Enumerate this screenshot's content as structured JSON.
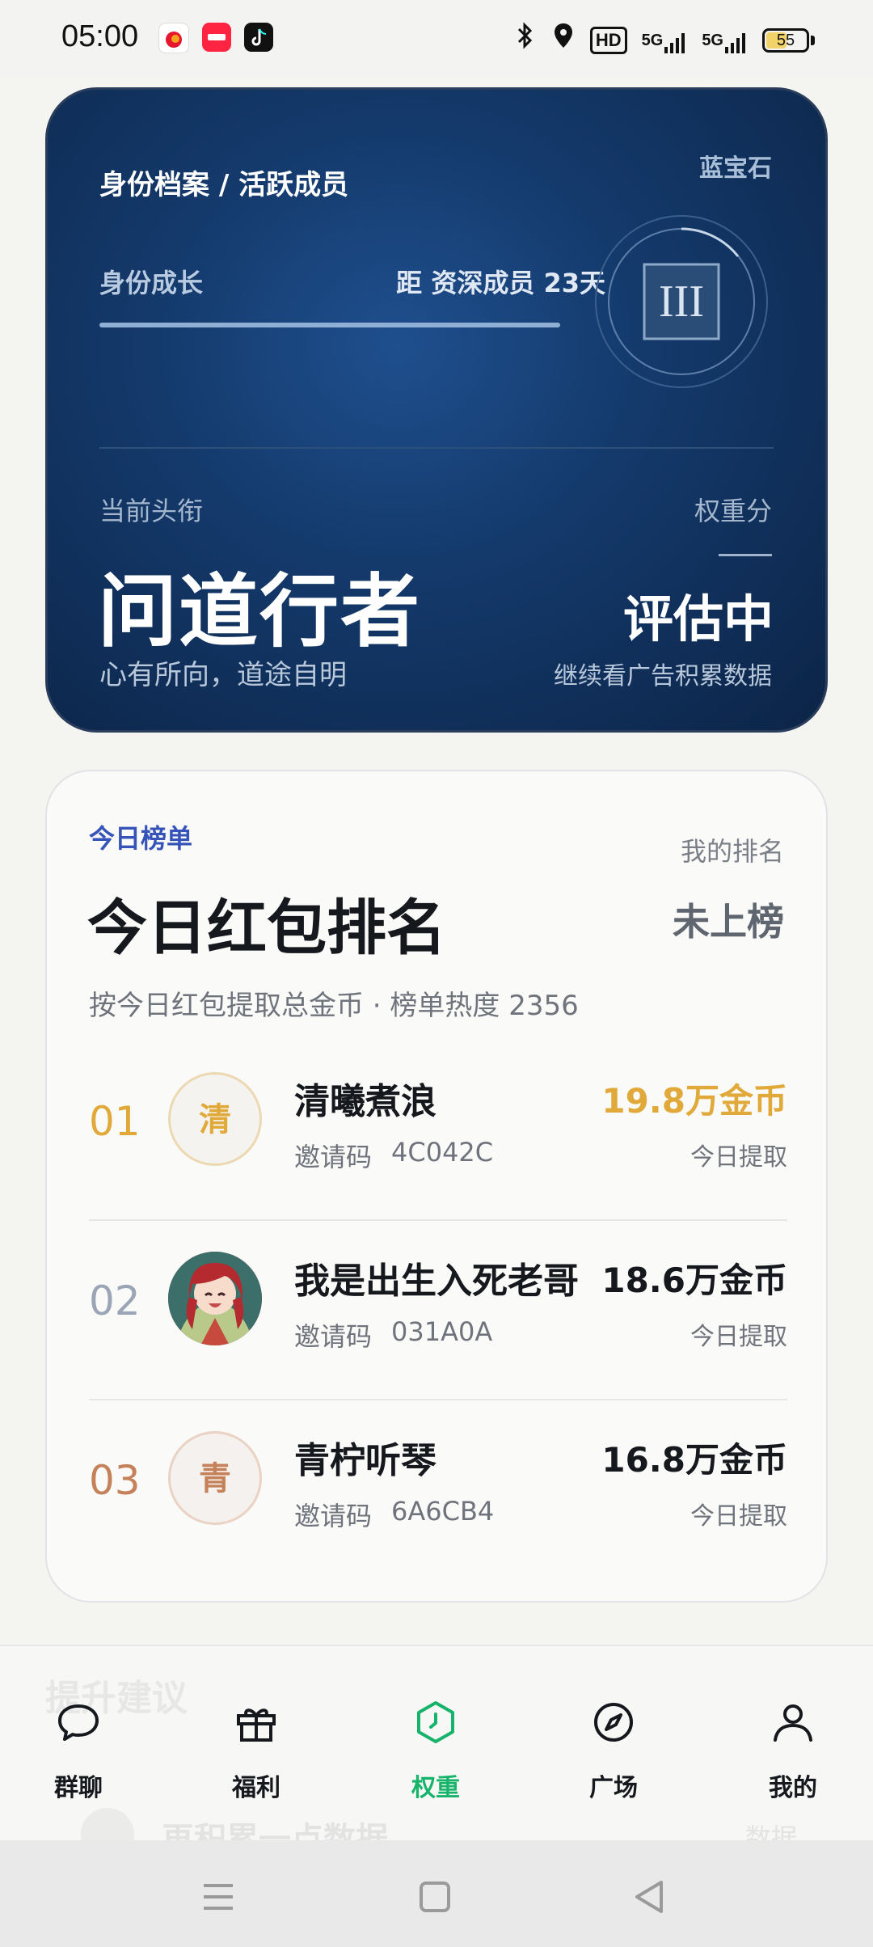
{
  "status_bar": {
    "time": "05:00",
    "battery": "55",
    "battery_level": 0.55,
    "icons": [
      "bluetooth-icon",
      "location-icon",
      "hd-icon",
      "5g-signal-icon",
      "5g-signal-icon",
      "battery-icon"
    ],
    "hd": "HD",
    "net1": "5G",
    "net2": "5G"
  },
  "identity": {
    "breadcrumb": "身份档案 / 活跃成员",
    "level": "蓝宝石",
    "growth_label": "身份成长",
    "growth_distance": "距 资深成员 23天",
    "growth_progress": 1.0,
    "badge_numeral": "III",
    "title_label": "当前头衔",
    "title": "问道行者",
    "subtitle": "心有所向，道途自明",
    "weight_label": "权重分",
    "weight_value": "评估中",
    "weight_hint": "继续看广告积累数据"
  },
  "ranking": {
    "eyebrow": "今日榜单",
    "my_rank_label": "我的排名",
    "title": "今日红包排名",
    "my_rank_status": "未上榜",
    "subtitle": "按今日红包提取总金币 · 榜单热度 2356",
    "code_label": "邀请码",
    "rows": [
      {
        "rank": "01",
        "avatar_char": "清",
        "name": "清曦煮浪",
        "code": "4C042C",
        "amount": "19.8万金币",
        "note": "今日提取"
      },
      {
        "rank": "02",
        "avatar_char": "",
        "name": "我是出生入死老哥",
        "code": "031A0A",
        "amount": "18.6万金币",
        "note": "今日提取"
      },
      {
        "rank": "03",
        "avatar_char": "青",
        "name": "青柠听琴",
        "code": "6A6CB4",
        "amount": "16.8万金币",
        "note": "今日提取"
      }
    ]
  },
  "peek": {
    "section_title": "提升建议",
    "row_text": "再积累一点数据",
    "row_tag": "数据"
  },
  "tabbar": {
    "tabs": [
      {
        "label": "群聊",
        "icon": "chat-bubble-icon"
      },
      {
        "label": "福利",
        "icon": "gift-icon"
      },
      {
        "label": "权重",
        "icon": "hexagon-clock-icon"
      },
      {
        "label": "广场",
        "icon": "compass-icon"
      },
      {
        "label": "我的",
        "icon": "person-icon"
      }
    ],
    "active": "权重"
  },
  "colors": {
    "accent_green": "#16b36a",
    "gold": "#e0a93a",
    "bronze": "#c5825a",
    "silver": "#9aa5b6",
    "eyebrow_blue": "#3553b8"
  }
}
